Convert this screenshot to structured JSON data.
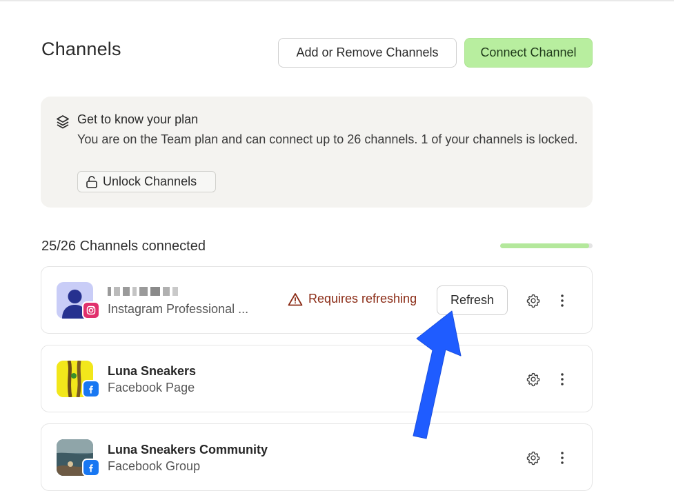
{
  "page": {
    "title": "Channels"
  },
  "header": {
    "add_remove_label": "Add or Remove Channels",
    "connect_label": "Connect Channel"
  },
  "plan": {
    "title": "Get to know your plan",
    "description": "You are on the Team plan and can connect up to 26 channels. 1 of your channels is locked.",
    "unlock_label": "Unlock Channels",
    "icon": "layers-icon"
  },
  "channels_summary": {
    "text": "25/26 Channels connected",
    "connected": 25,
    "limit": 26,
    "progress_color": "#b4e89c"
  },
  "channels": [
    {
      "name": "",
      "type": "Instagram Professional ...",
      "network": "instagram",
      "warning": "Requires refreshing",
      "action_label": "Refresh"
    },
    {
      "name": "Luna Sneakers",
      "type": "Facebook Page",
      "network": "facebook"
    },
    {
      "name": "Luna Sneakers Community",
      "type": "Facebook Group",
      "network": "facebook"
    }
  ],
  "colors": {
    "primary_button": "#b8ee9f",
    "warning_text": "#8a2a14",
    "annotation_arrow": "#1f5cff",
    "instagram_badge": "#e1306c",
    "facebook_badge": "#1877f2"
  }
}
